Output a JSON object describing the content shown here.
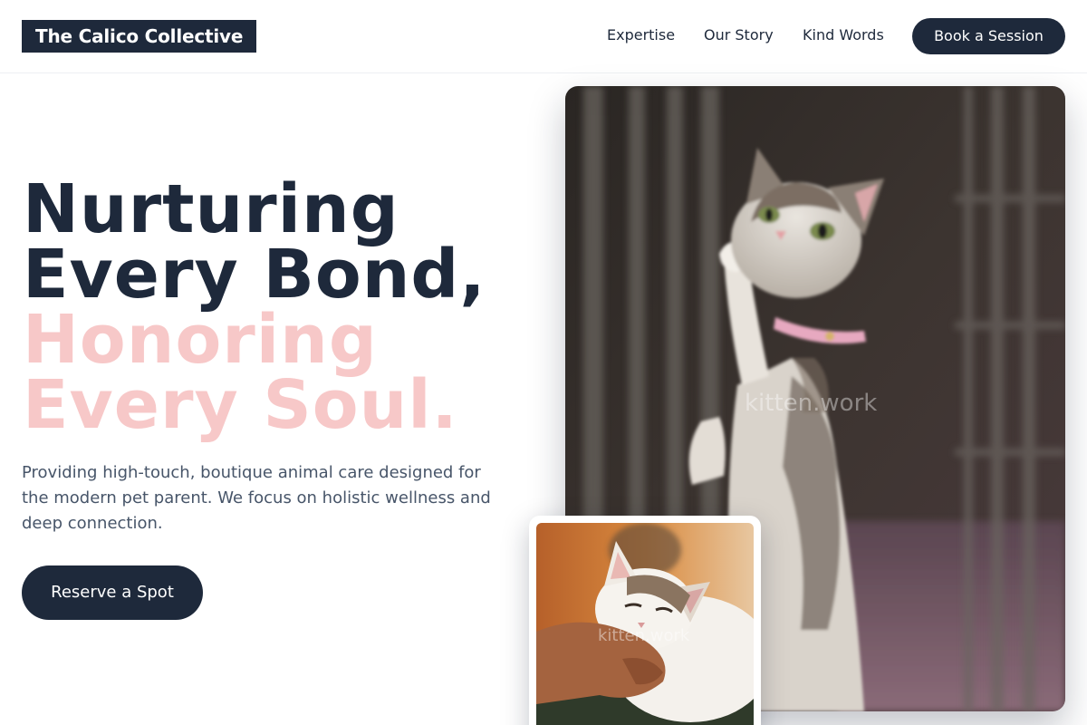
{
  "brand": {
    "name": "The Calico Collective"
  },
  "nav": {
    "links": [
      "Expertise",
      "Our Story",
      "Kind Words"
    ],
    "cta": "Book a Session"
  },
  "hero": {
    "line1": "Nurturing",
    "line2": "Every Bond,",
    "line3": "Honoring",
    "line4": "Every Soul.",
    "description": "Providing high-touch, boutique animal care designed for the modern pet parent. We focus on holistic wellness and deep connection.",
    "button": "Reserve a Spot"
  },
  "images": {
    "main_watermark": "kitten.work",
    "small_watermark": "kitten.work"
  },
  "colors": {
    "navy": "#1e293b",
    "pink": "#f7c8c8",
    "muted": "#475569"
  }
}
